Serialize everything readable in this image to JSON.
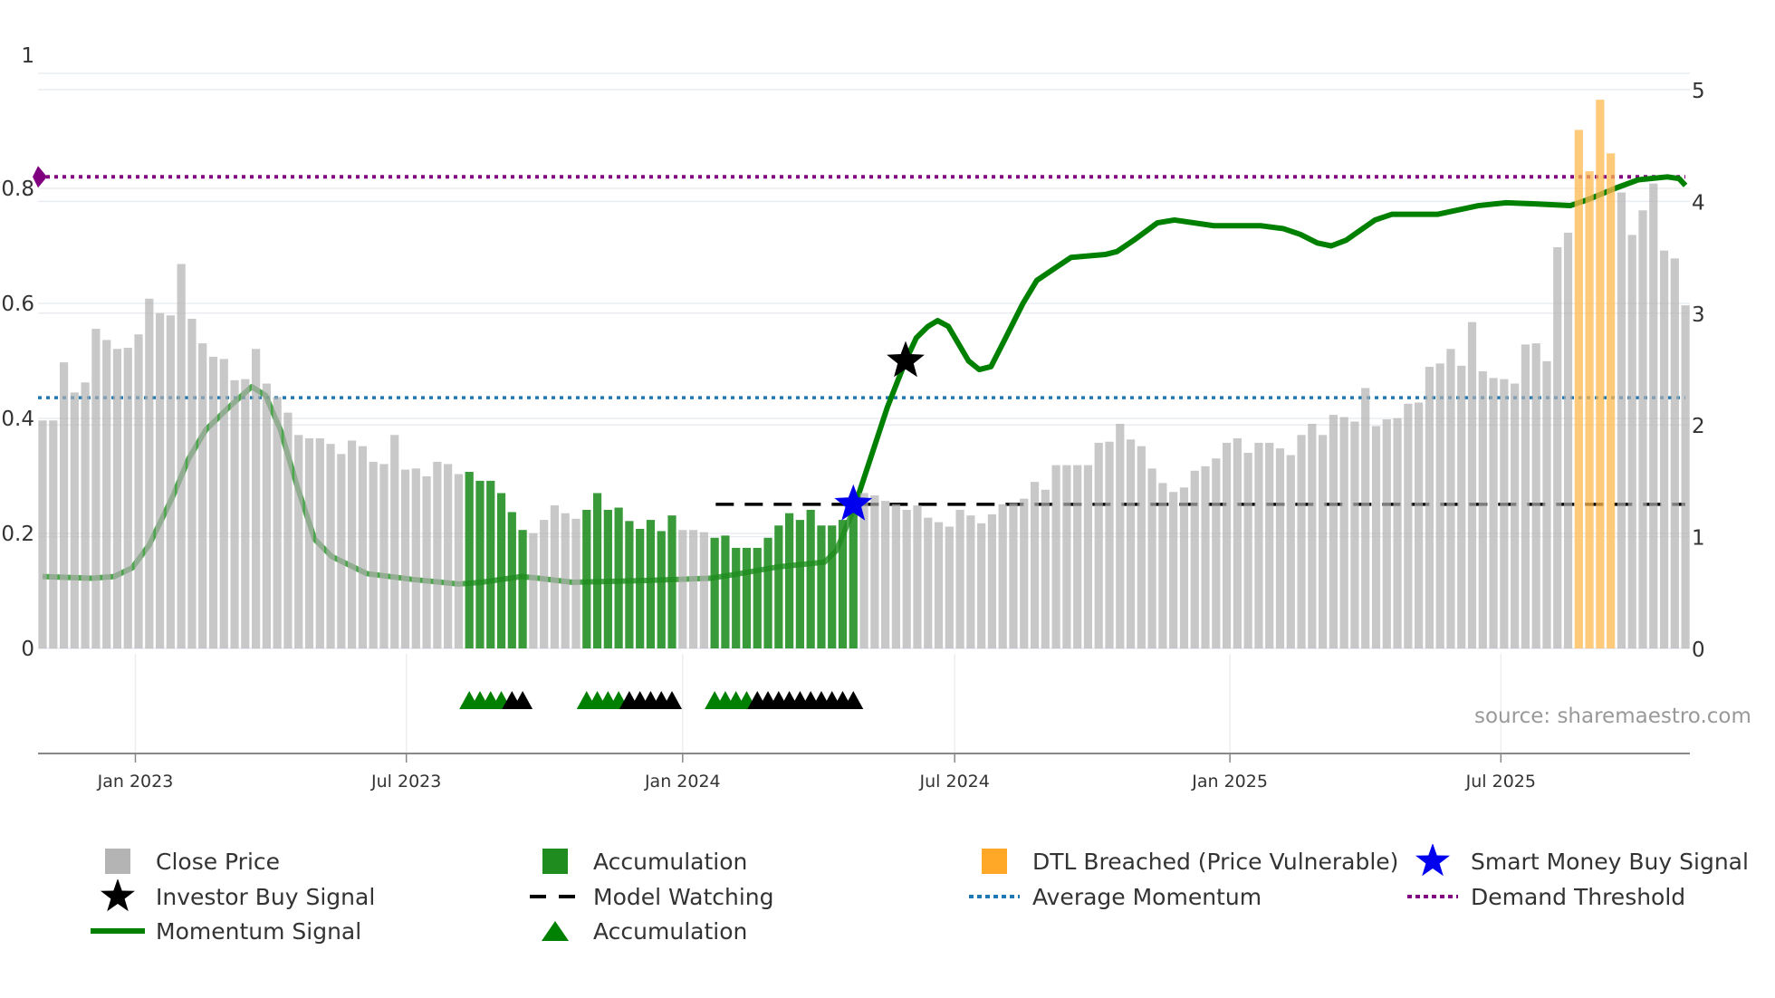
{
  "chart_data": {
    "type": "bar",
    "x_unit": "week index",
    "left_axis": {
      "range": [
        0,
        1
      ],
      "ticks": [
        "0",
        "0.2",
        "0.4",
        "0.6",
        "0.8",
        "1"
      ],
      "tick_values": [
        0,
        0.2,
        0.4,
        0.6,
        0.8,
        1
      ]
    },
    "right_axis": {
      "range": [
        0,
        5
      ],
      "ticks": [
        "0",
        "1",
        "2",
        "3",
        "4",
        "5"
      ],
      "tick_values": [
        0,
        1,
        2,
        3,
        4,
        5
      ]
    },
    "x_ticks": [
      {
        "label": "Jan 2023",
        "x": 8.7
      },
      {
        "label": "Jul 2023",
        "x": 34.1
      },
      {
        "label": "Jan 2024",
        "x": 60.0
      },
      {
        "label": "Jul 2024",
        "x": 85.5
      },
      {
        "label": "Jan 2025",
        "x": 111.3
      },
      {
        "label": "Jul 2025",
        "x": 136.7
      }
    ],
    "grid": true,
    "close_price": [
      2.04,
      2.04,
      2.56,
      2.29,
      2.38,
      2.86,
      2.76,
      2.68,
      2.69,
      2.81,
      3.13,
      3.0,
      2.98,
      3.44,
      2.95,
      2.73,
      2.61,
      2.59,
      2.4,
      2.41,
      2.68,
      2.37,
      2.25,
      2.11,
      1.91,
      1.88,
      1.88,
      1.83,
      1.74,
      1.86,
      1.81,
      1.67,
      1.65,
      1.91,
      1.6,
      1.61,
      1.54,
      1.67,
      1.65,
      1.56,
      1.58,
      1.5,
      1.5,
      1.39,
      1.22,
      1.06,
      1.03,
      1.15,
      1.28,
      1.21,
      1.16,
      1.24,
      1.39,
      1.24,
      1.26,
      1.14,
      1.07,
      1.15,
      1.05,
      1.19,
      1.06,
      1.06,
      1.04,
      0.99,
      1.01,
      0.9,
      0.9,
      0.9,
      0.99,
      1.1,
      1.21,
      1.15,
      1.24,
      1.1,
      1.1,
      1.15,
      1.28,
      1.39,
      1.37,
      1.32,
      1.29,
      1.24,
      1.28,
      1.17,
      1.13,
      1.09,
      1.24,
      1.19,
      1.12,
      1.2,
      1.29,
      1.3,
      1.34,
      1.49,
      1.42,
      1.64,
      1.64,
      1.64,
      1.64,
      1.84,
      1.85,
      2.01,
      1.87,
      1.81,
      1.61,
      1.48,
      1.4,
      1.44,
      1.59,
      1.63,
      1.7,
      1.84,
      1.88,
      1.75,
      1.84,
      1.84,
      1.79,
      1.73,
      1.91,
      2.01,
      1.91,
      2.09,
      2.07,
      2.03,
      2.33,
      1.99,
      2.05,
      2.06,
      2.19,
      2.2,
      2.52,
      2.55,
      2.68,
      2.53,
      2.92,
      2.48,
      2.42,
      2.41,
      2.37,
      2.72,
      2.73,
      2.57,
      3.59,
      3.72,
      4.64,
      4.27,
      4.91,
      4.43,
      4.08,
      3.7,
      3.92,
      4.16,
      3.56,
      3.49,
      3.07
    ],
    "accumulation_ranges": [
      [
        40,
        45
      ],
      [
        51,
        59
      ],
      [
        63,
        76
      ]
    ],
    "accumulation_triangle_green_count": 4,
    "dtl_breached_range": [
      144,
      147
    ],
    "momentum_signal": [
      [
        0,
        0.125
      ],
      [
        4.6,
        0.122
      ],
      [
        6.7,
        0.125
      ],
      [
        8.4,
        0.14
      ],
      [
        10,
        0.18
      ],
      [
        12.1,
        0.26
      ],
      [
        13.7,
        0.33
      ],
      [
        15.3,
        0.38
      ],
      [
        17.5,
        0.42
      ],
      [
        19.6,
        0.455
      ],
      [
        20.9,
        0.44
      ],
      [
        22.3,
        0.38
      ],
      [
        23.9,
        0.28
      ],
      [
        25.5,
        0.19
      ],
      [
        27.1,
        0.16
      ],
      [
        30.4,
        0.13
      ],
      [
        34.7,
        0.12
      ],
      [
        39,
        0.112
      ],
      [
        41.1,
        0.115
      ],
      [
        44.9,
        0.125
      ],
      [
        46.5,
        0.122
      ],
      [
        49.7,
        0.115
      ],
      [
        56.2,
        0.118
      ],
      [
        62.6,
        0.122
      ],
      [
        64.7,
        0.128
      ],
      [
        69,
        0.142
      ],
      [
        73.3,
        0.15
      ],
      [
        74.4,
        0.17
      ],
      [
        76,
        0.24
      ],
      [
        77.6,
        0.33
      ],
      [
        79.2,
        0.42
      ],
      [
        80.9,
        0.5
      ],
      [
        81.9,
        0.54
      ],
      [
        83,
        0.56
      ],
      [
        83.9,
        0.57
      ],
      [
        84.9,
        0.56
      ],
      [
        86.8,
        0.5
      ],
      [
        87.8,
        0.485
      ],
      [
        88.9,
        0.49
      ],
      [
        90,
        0.53
      ],
      [
        91.9,
        0.6
      ],
      [
        93.2,
        0.64
      ],
      [
        94.8,
        0.66
      ],
      [
        96.4,
        0.68
      ],
      [
        99.6,
        0.685
      ],
      [
        100.7,
        0.69
      ],
      [
        102.3,
        0.71
      ],
      [
        104.5,
        0.74
      ],
      [
        106.1,
        0.745
      ],
      [
        109.8,
        0.735
      ],
      [
        114.2,
        0.735
      ],
      [
        116.3,
        0.73
      ],
      [
        117.9,
        0.72
      ],
      [
        119.5,
        0.705
      ],
      [
        120.8,
        0.7
      ],
      [
        122.2,
        0.71
      ],
      [
        124.9,
        0.745
      ],
      [
        126.5,
        0.755
      ],
      [
        130.8,
        0.755
      ],
      [
        134.6,
        0.77
      ],
      [
        137.2,
        0.775
      ],
      [
        139.9,
        0.773
      ],
      [
        143.2,
        0.77
      ],
      [
        144.8,
        0.78
      ],
      [
        147.4,
        0.8
      ],
      [
        149.6,
        0.815
      ],
      [
        152.3,
        0.82
      ],
      [
        153.4,
        0.817
      ],
      [
        154,
        0.805
      ]
    ],
    "average_momentum": 0.436,
    "demand_threshold": 0.82,
    "model_watching": {
      "start": 63.1,
      "value_right_axis": 1.29
    },
    "smart_money_buy_signal": {
      "x": 76,
      "value_right_axis": 1.29
    },
    "investor_buy_signal": {
      "x": 80.9,
      "value": 0.5
    },
    "legend_placement": "bottom",
    "legend": [
      {
        "label": "Close Price",
        "marker": "square",
        "color": "#b4b4b4"
      },
      {
        "label": "Accumulation",
        "marker": "square",
        "color": "#1e8c1e"
      },
      {
        "label": "DTL Breached (Price Vulnerable)",
        "marker": "square",
        "color": "#ffa726"
      },
      {
        "label": "Smart Money Buy Signal",
        "marker": "star",
        "color": "#0000ee"
      },
      {
        "label": "Investor Buy Signal",
        "marker": "star",
        "color": "#000000"
      },
      {
        "label": "Model Watching",
        "marker": "dash",
        "color": "#000000"
      },
      {
        "label": "Average Momentum",
        "marker": "dot",
        "color": "#1f77b4"
      },
      {
        "label": "Demand Threshold",
        "marker": "dot",
        "color": "#800080"
      },
      {
        "label": "Momentum Signal",
        "marker": "line",
        "color": "#008000"
      },
      {
        "label": "Accumulation",
        "marker": "triangle",
        "color": "#008000"
      }
    ],
    "colors": {
      "close": "#b0b0b0",
      "accum": "#1e8c1e",
      "dtl": "#ffb84d",
      "momentum": "#008000",
      "avg": "#1f77b4",
      "demand": "#800080",
      "grid": "#e9edf2",
      "axis": "#888888"
    }
  },
  "source_text": "source: sharemaestro.com"
}
